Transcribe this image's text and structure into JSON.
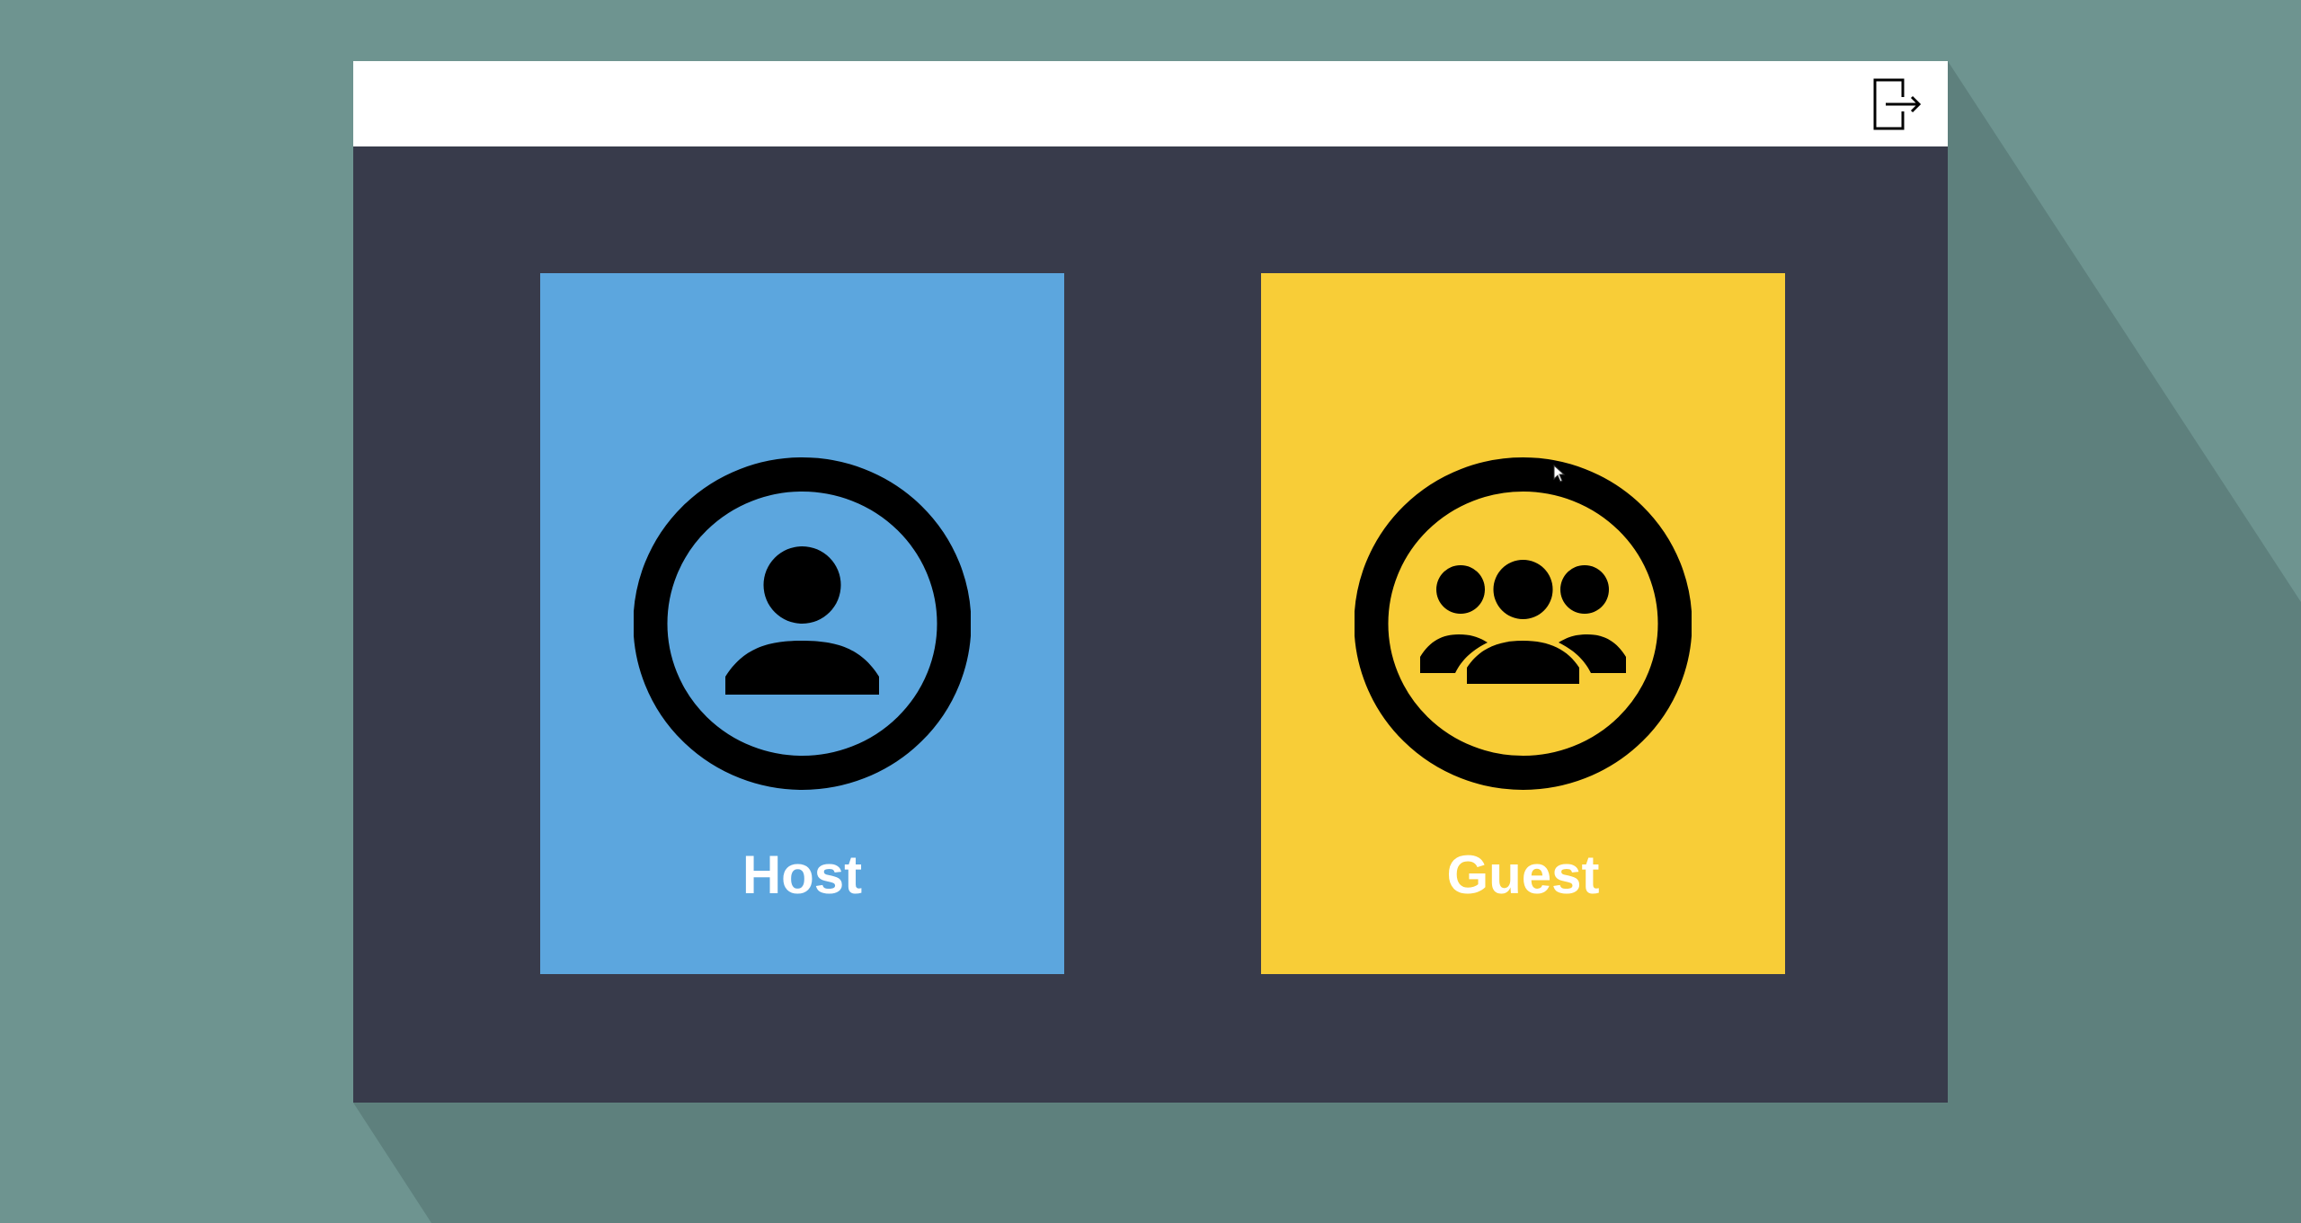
{
  "colors": {
    "background": "#6e9490",
    "long_shadow": "#5e807d",
    "window_body": "#383b4b",
    "titlebar": "#ffffff",
    "icon_ink": "#000000",
    "label_text": "#ffffff"
  },
  "titlebar": {
    "exit_icon": "exit-door-arrow-icon"
  },
  "roles": [
    {
      "label": "Host",
      "color": "#5ca6de",
      "icon": "single-user-circle-icon"
    },
    {
      "label": "Guest",
      "color": "#f8cd37",
      "icon": "user-group-circle-icon"
    }
  ],
  "cursor": {
    "icon": "mouse-pointer-icon"
  }
}
